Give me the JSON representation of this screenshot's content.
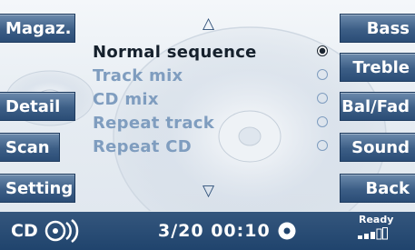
{
  "left_buttons": [
    {
      "label": "Magaz."
    },
    {
      "label": "Detail"
    },
    {
      "label": "Scan"
    },
    {
      "label": "Setting"
    }
  ],
  "right_buttons": [
    {
      "label": "Bass"
    },
    {
      "label": "Treble"
    },
    {
      "label": "Bal/Fad"
    },
    {
      "label": "Sound"
    },
    {
      "label": "Back"
    }
  ],
  "playback_modes": [
    {
      "label": "Normal sequence",
      "selected": true
    },
    {
      "label": "Track mix",
      "selected": false
    },
    {
      "label": "CD mix",
      "selected": false
    },
    {
      "label": "Repeat track",
      "selected": false
    },
    {
      "label": "Repeat CD",
      "selected": false
    }
  ],
  "scroll": {
    "up": "△",
    "down": "▽"
  },
  "status": {
    "source": "CD",
    "track_time": "3/20 00:10",
    "ready": "Ready"
  },
  "colors": {
    "button": "#3c5e86",
    "status_bar": "#20446d",
    "selected_text": "#15202c",
    "unselected_text": "#7f9dbf"
  },
  "icons": [
    "cd-icon",
    "play-disc-icon",
    "signal-strength-icon",
    "radio-selected-icon",
    "radio-empty-icon"
  ]
}
